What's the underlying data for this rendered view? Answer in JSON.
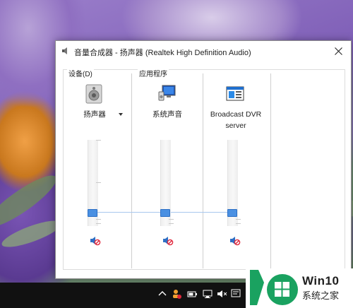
{
  "window": {
    "title": "音量合成器 - 扬声器 (Realtek High Definition Audio)"
  },
  "groups": {
    "device_label": "设备(D)",
    "apps_label": "应用程序"
  },
  "device": {
    "name": "扬声器",
    "volume": 0.0,
    "muted": true,
    "icon": "speaker-icon"
  },
  "apps": [
    {
      "name": "系统声音",
      "volume": 0.0,
      "muted": true,
      "icon": "monitor-speaker-icon"
    },
    {
      "name": "Broadcast DVR server",
      "volume": 0.0,
      "muted": true,
      "icon": "app-window-icon"
    }
  ],
  "brand": {
    "main": "Win10",
    "sub": "系统之家",
    "accent": "#1aa260"
  },
  "colors": {
    "slider_thumb": "#4a90e2",
    "mute_red": "#e0263a"
  }
}
